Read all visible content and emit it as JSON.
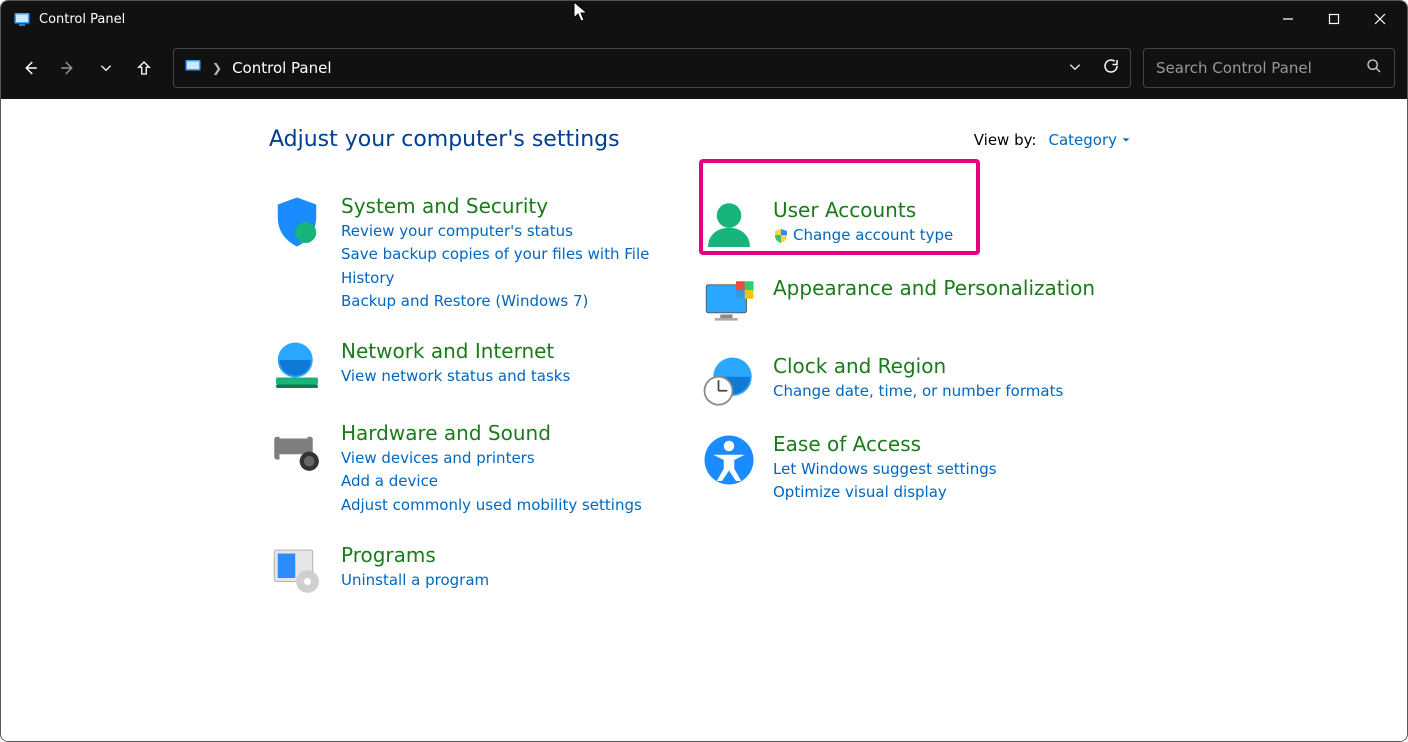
{
  "window_title": "Control Panel",
  "breadcrumb": "Control Panel",
  "search_placeholder": "Search Control Panel",
  "heading": "Adjust your computer's settings",
  "viewby": {
    "label": "View by:",
    "value": "Category"
  },
  "left": [
    {
      "title": "System and Security",
      "links": [
        {
          "label": "Review your computer's status"
        },
        {
          "label": "Save backup copies of your files with File History"
        },
        {
          "label": "Backup and Restore (Windows 7)"
        }
      ]
    },
    {
      "title": "Network and Internet",
      "links": [
        {
          "label": "View network status and tasks"
        }
      ]
    },
    {
      "title": "Hardware and Sound",
      "links": [
        {
          "label": "View devices and printers"
        },
        {
          "label": "Add a device"
        },
        {
          "label": "Adjust commonly used mobility settings"
        }
      ]
    },
    {
      "title": "Programs",
      "links": [
        {
          "label": "Uninstall a program"
        }
      ]
    }
  ],
  "right": [
    {
      "title": "User Accounts",
      "links": [
        {
          "label": "Change account type",
          "shield": true
        }
      ]
    },
    {
      "title": "Appearance and Personalization",
      "links": []
    },
    {
      "title": "Clock and Region",
      "links": [
        {
          "label": "Change date, time, or number formats"
        }
      ]
    },
    {
      "title": "Ease of Access",
      "links": [
        {
          "label": "Let Windows suggest settings"
        },
        {
          "label": "Optimize visual display"
        }
      ]
    }
  ]
}
